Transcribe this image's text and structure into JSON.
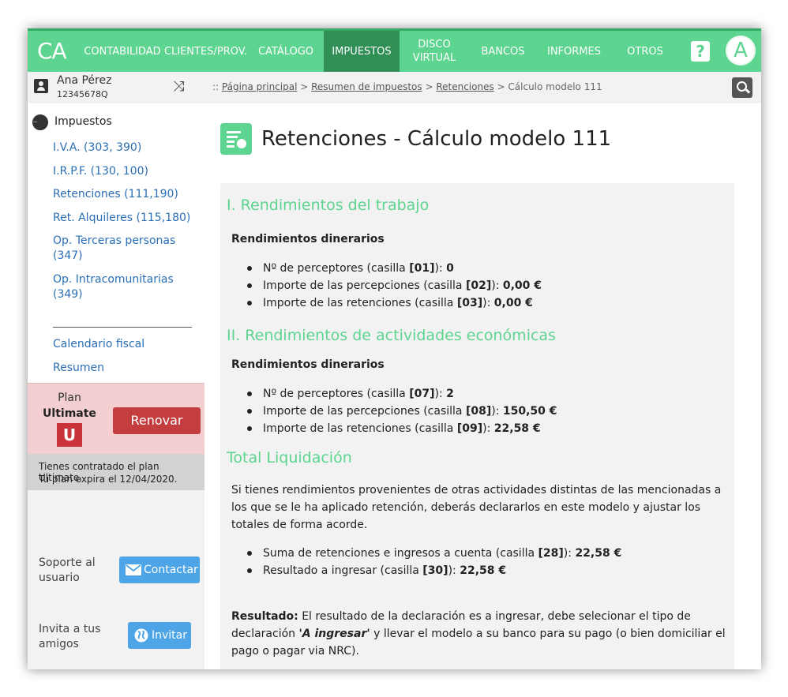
{
  "app": {
    "logo": "CA"
  },
  "nav": [
    {
      "label": "CONTABILIDAD"
    },
    {
      "label": "CLIENTES/PROV."
    },
    {
      "label": "CATÁLOGO"
    },
    {
      "label": "IMPUESTOS"
    },
    {
      "label": "DISCO",
      "label2": "VIRTUAL"
    },
    {
      "label": "BANCOS"
    },
    {
      "label": "INFORMES"
    },
    {
      "label": "OTROS"
    }
  ],
  "header": {
    "help": "?",
    "avatar": "A"
  },
  "user": {
    "name": "Ana Pérez",
    "id": "12345678Q"
  },
  "sidebar": {
    "section_title": "Impuestos",
    "items": [
      {
        "label": "I.V.A. (303, 390)"
      },
      {
        "label": "I.R.P.F. (130, 100)"
      },
      {
        "label": "Retenciones (111,190)"
      },
      {
        "label": "Ret. Alquileres (115,180)"
      },
      {
        "label": "Op. Terceras personas (347)"
      },
      {
        "label": "Op. Intracomunitarias (349)"
      },
      {
        "label": "Calendario fiscal"
      },
      {
        "label": "Resumen"
      }
    ]
  },
  "plan": {
    "label": "Plan",
    "name": "Ultimate",
    "badge": "U",
    "renew": "Renovar",
    "info_line1": "Tienes contratado el plan Ultimate.",
    "info_line2": "Tu plan expira el 12/04/2020."
  },
  "support": {
    "label1": "Soporte al",
    "label2": "usuario",
    "button": "Contactar",
    "invite1": "Invita a tus",
    "invite2": "amigos",
    "invite_button": "Invitar"
  },
  "breadcrumb": {
    "prefix": ":: ",
    "items": [
      "Página principal",
      "Resumen de impuestos",
      "Retenciones"
    ],
    "current": "Cálculo modelo 111",
    "sep": " > "
  },
  "page": {
    "title": "Retenciones - Cálculo modelo 111",
    "sec1": {
      "title": "I. Rendimientos del trabajo",
      "subtitle": "Rendimientos dinerarios",
      "rows": [
        {
          "label": "Nº de perceptores (casilla ",
          "box": "[01]",
          "end": "): ",
          "value": "0"
        },
        {
          "label": "Importe de las percepciones (casilla ",
          "box": "[02]",
          "end": "): ",
          "value": "0,00 €"
        },
        {
          "label": "Importe de las retenciones (casilla ",
          "box": "[03]",
          "end": "): ",
          "value": "0,00 €"
        }
      ]
    },
    "sec2": {
      "title": "II. Rendimientos de actividades económicas",
      "subtitle": "Rendimientos dinerarios",
      "rows": [
        {
          "label": "Nº de perceptores (casilla ",
          "box": "[07]",
          "end": "): ",
          "value": "2"
        },
        {
          "label": "Importe de las percepciones (casilla ",
          "box": "[08]",
          "end": "): ",
          "value": "150,50 €"
        },
        {
          "label": "Importe de las retenciones (casilla ",
          "box": "[09]",
          "end": "): ",
          "value": "22,58 €"
        }
      ]
    },
    "sec3": {
      "title": "Total Liquidación",
      "para": "Si tienes rendimientos provenientes de otras actividades distintas de las mencionadas a los que se le ha aplicado retención, deberás declararlos en este modelo y ajustar los totales de forma acorde.",
      "rows": [
        {
          "label": "Suma de retenciones e ingresos a cuenta (casilla ",
          "box": "[28]",
          "end": "): ",
          "value": "22,58 €"
        },
        {
          "label": "Resultado a ingresar (casilla ",
          "box": "[30]",
          "end": "): ",
          "value": "22,58 €"
        }
      ],
      "result_label": "Resultado:",
      "result_text1": " El resultado de la declaración es a ingresar, debe selecionar el tipo de declaración ",
      "result_em": "'A ingresar'",
      "result_text2": " y llevar el modelo a su banco para su pago (o bien domiciliar el pago o pagar via NRC)."
    }
  },
  "colors": {
    "brand": "#5dd48f",
    "nav_active": "#2f8f55",
    "renew": "#c43d3f",
    "button_blue": "#4da4e6"
  }
}
